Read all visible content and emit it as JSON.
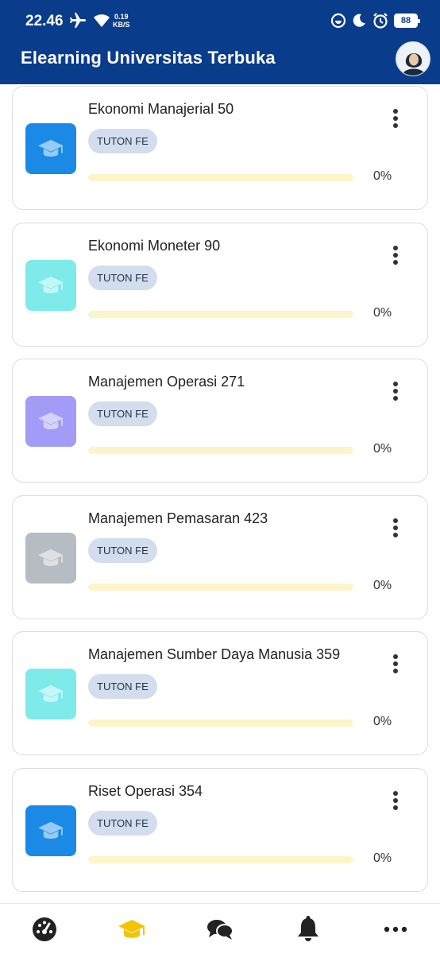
{
  "status_bar": {
    "time": "22.46",
    "speed_value": "0.19",
    "speed_unit": "KB/S",
    "battery": "88"
  },
  "header": {
    "title": "Elearning Universitas Terbuka"
  },
  "colors": {
    "header_bg": "#0a3c8c",
    "badge_bg": "#d2dded",
    "progress_track": "#fdf5c8",
    "nav_active": "#f5c400"
  },
  "courses": [
    {
      "title": "Ekonomi Manajerial 50",
      "badge": "TUTON FE",
      "progress_value": 0,
      "progress_label": "0%",
      "icon_color": "#1a8ae6",
      "icon": "graduation-cap-icon"
    },
    {
      "title": "Ekonomi Moneter 90",
      "badge": "TUTON FE",
      "progress_value": 0,
      "progress_label": "0%",
      "icon_color": "#7eeaea",
      "icon": "graduation-cap-icon"
    },
    {
      "title": "Manajemen Operasi 271",
      "badge": "TUTON FE",
      "progress_value": 0,
      "progress_label": "0%",
      "icon_color": "#a29cf7",
      "icon": "graduation-cap-icon"
    },
    {
      "title": "Manajemen Pemasaran 423",
      "badge": "TUTON FE",
      "progress_value": 0,
      "progress_label": "0%",
      "icon_color": "#b5bcc2",
      "icon": "graduation-cap-icon"
    },
    {
      "title": "Manajemen Sumber Daya Manusia 359",
      "badge": "TUTON FE",
      "progress_value": 0,
      "progress_label": "0%",
      "icon_color": "#7eeaea",
      "icon": "graduation-cap-icon"
    },
    {
      "title": "Riset Operasi 354",
      "badge": "TUTON FE",
      "progress_value": 0,
      "progress_label": "0%",
      "icon_color": "#1a8ae6",
      "icon": "graduation-cap-icon"
    }
  ],
  "bottom_nav": [
    {
      "icon": "dashboard-gauge-icon",
      "active": false
    },
    {
      "icon": "graduation-cap-icon",
      "active": true
    },
    {
      "icon": "chat-bubbles-icon",
      "active": false
    },
    {
      "icon": "bell-icon",
      "active": false
    },
    {
      "icon": "more-horizontal-icon",
      "active": false
    }
  ]
}
